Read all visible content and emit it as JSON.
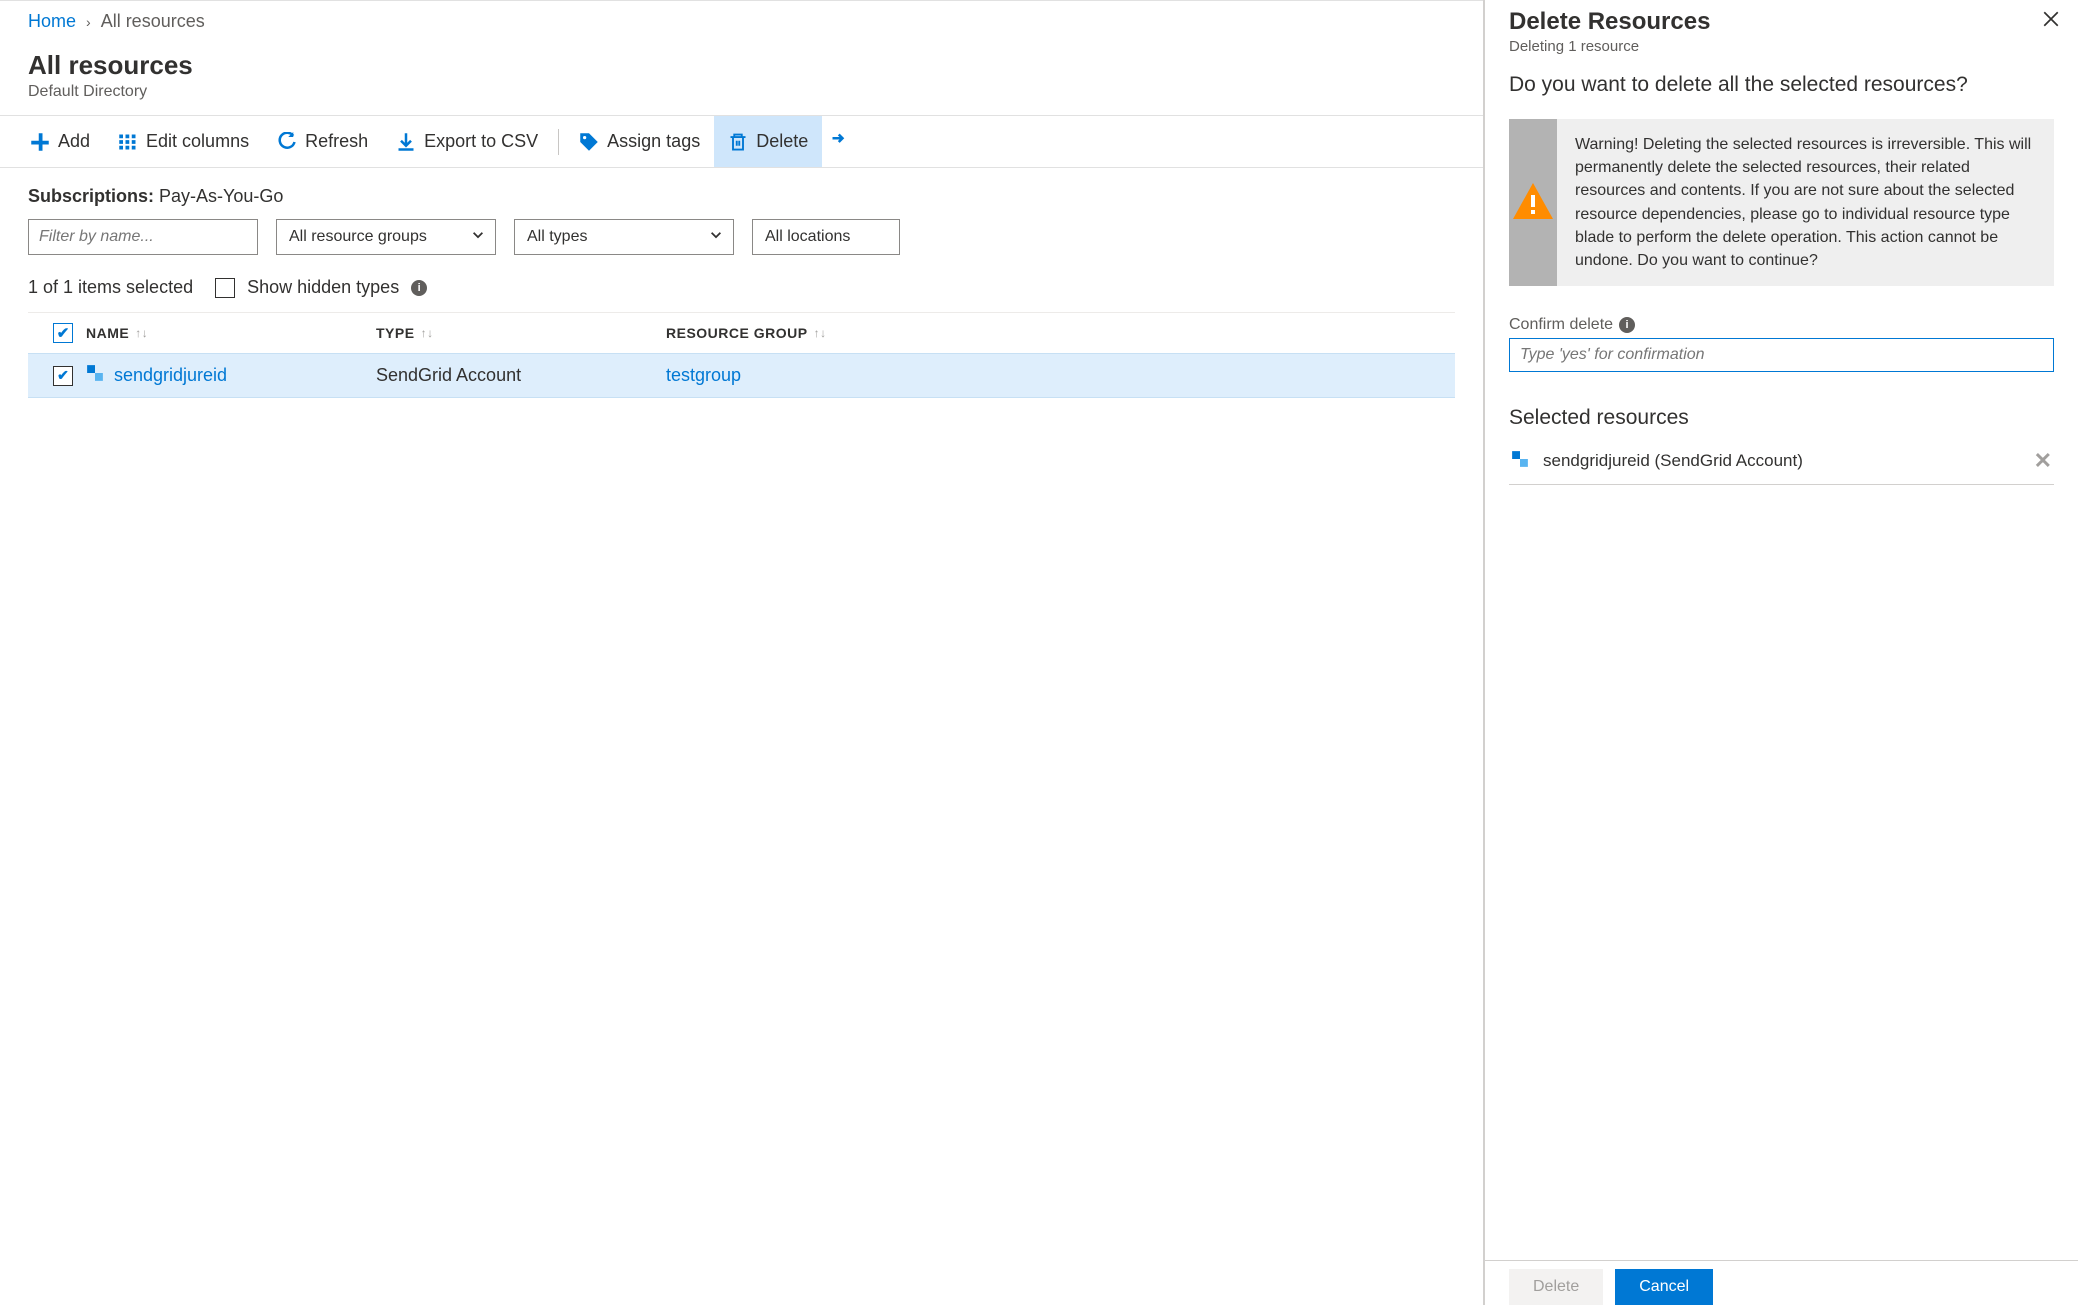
{
  "breadcrumb": {
    "home": "Home",
    "current": "All resources"
  },
  "header": {
    "title": "All resources",
    "subtitle": "Default Directory"
  },
  "toolbar": {
    "add": "Add",
    "edit_columns": "Edit columns",
    "refresh": "Refresh",
    "export_csv": "Export to CSV",
    "assign_tags": "Assign tags",
    "delete": "Delete"
  },
  "filters": {
    "subs_label": "Subscriptions:",
    "subs_value": "Pay-As-You-Go",
    "name_placeholder": "Filter by name...",
    "resource_groups": "All resource groups",
    "types": "All types",
    "locations": "All locations"
  },
  "status": {
    "selected_text": "1 of 1 items selected",
    "show_hidden": "Show hidden types"
  },
  "columns": {
    "name": "NAME",
    "type": "TYPE",
    "rg": "RESOURCE GROUP"
  },
  "rows": [
    {
      "name": "sendgridjureid",
      "type": "SendGrid Account",
      "rg": "testgroup"
    }
  ],
  "panel": {
    "title": "Delete Resources",
    "subtitle": "Deleting 1 resource",
    "question": "Do you want to delete all the selected resources?",
    "warning": "Warning! Deleting the selected resources is irreversible. This will permanently delete the selected resources, their related resources and contents. If you are not sure about the selected resource dependencies, please go to individual resource type blade to perform the delete operation. This action cannot be undone. Do you want to continue?",
    "confirm_label": "Confirm delete",
    "confirm_placeholder": "Type 'yes' for confirmation",
    "selected_title": "Selected resources",
    "selected_item": "sendgridjureid (SendGrid Account)",
    "delete_btn": "Delete",
    "cancel_btn": "Cancel"
  }
}
